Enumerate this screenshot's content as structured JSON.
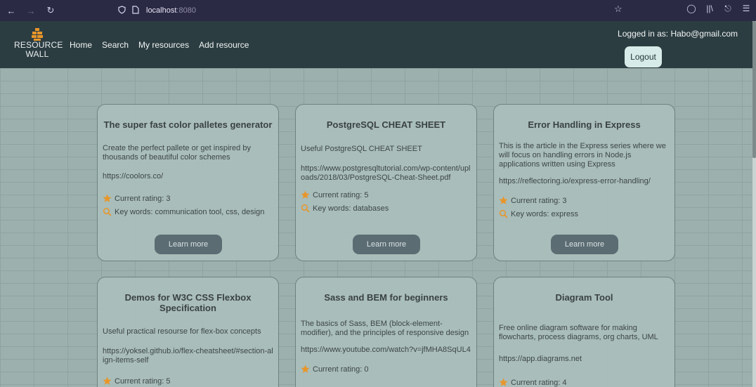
{
  "browser": {
    "url_host": "localhost",
    "url_port": ":8080",
    "icons": [
      "back-arrow-icon",
      "forward-arrow-icon",
      "reload-icon",
      "shield-icon",
      "page-icon",
      "bookmark-star-icon",
      "pocket-icon",
      "library-icon",
      "extensions-icon",
      "menu-icon"
    ]
  },
  "header": {
    "logo_line1": "RESOURCE",
    "logo_line2": "WALL",
    "nav": {
      "home": "Home",
      "search": "Search",
      "my_resources": "My resources",
      "add_resource": "Add resource"
    },
    "login_text": "Logged in as: Habo@gmail.com",
    "logout": "Logout",
    "accent": "#e8962a"
  },
  "cards": [
    {
      "title": "The super fast color palletes generator",
      "description": "Create the perfect pallete or get inspired by thousands of beautiful color schemes",
      "url": "https://coolors.co/",
      "rating": "Current rating: 3",
      "keywords": "Key words: communication tool, css, design",
      "button": "Learn more"
    },
    {
      "title": "PostgreSQL CHEAT SHEET",
      "description": "Useful PostgreSQL CHEAT SHEET",
      "url": "https://www.postgresqltutorial.com/wp-content/uploads/2018/03/PostgreSQL-Cheat-Sheet.pdf",
      "rating": "Current rating: 5",
      "keywords": "Key words: databases",
      "button": "Learn more"
    },
    {
      "title": "Error Handling in Express",
      "description": "This is the article in the Express series where we will focus on handling errors in Node.js applications written using Express",
      "url": "https://reflectoring.io/express-error-handling/",
      "rating": "Current rating: 3",
      "keywords": "Key words: express",
      "button": "Learn more"
    },
    {
      "title": "Demos for W3C CSS Flexbox Specification",
      "description": "Useful practical resourse for flex-box concepts",
      "url": "https://yoksel.github.io/flex-cheatsheet/#section-align-items-self",
      "rating": "Current rating: 5"
    },
    {
      "title": "Sass and BEM for beginners",
      "description": "The basics of Sass, BEM (block-element-modifier), and the principles of responsive design",
      "url": "https://www.youtube.com/watch?v=jfMHA8SqUL4",
      "rating": "Current rating: 0"
    },
    {
      "title": "Diagram Tool",
      "description": "Free online diagram software for making flowcharts, process diagrams, org charts, UML",
      "url": "https://app.diagrams.net",
      "rating": "Current rating: 4"
    }
  ]
}
